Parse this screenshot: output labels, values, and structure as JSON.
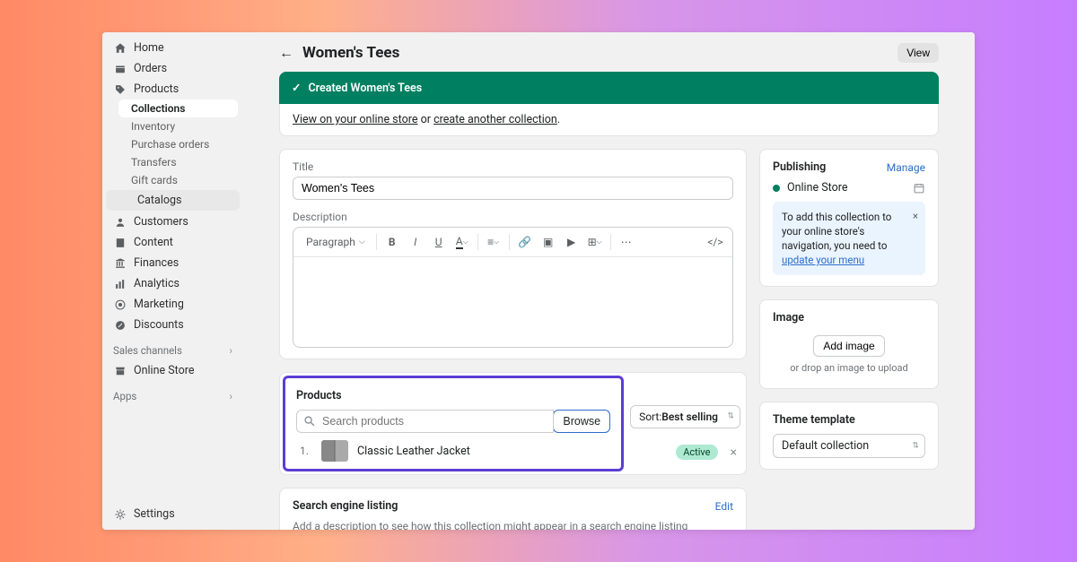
{
  "sidebar": {
    "home": "Home",
    "orders": "Orders",
    "products": "Products",
    "products_sub": [
      "Collections",
      "Inventory",
      "Purchase orders",
      "Transfers",
      "Gift cards"
    ],
    "catalogs": "Catalogs",
    "customers": "Customers",
    "content": "Content",
    "finances": "Finances",
    "analytics": "Analytics",
    "marketing": "Marketing",
    "discounts": "Discounts",
    "channels_head": "Sales channels",
    "online_store": "Online Store",
    "apps_head": "Apps",
    "settings": "Settings"
  },
  "header": {
    "title": "Women's Tees",
    "view": "View"
  },
  "banner": {
    "title": "Created Women's Tees",
    "link1": "View on your online store",
    "or": " or ",
    "link2": "create another collection"
  },
  "form": {
    "title_label": "Title",
    "title_value": "Women's Tees",
    "desc_label": "Description",
    "paragraph": "Paragraph"
  },
  "products": {
    "title": "Products",
    "search_placeholder": "Search products",
    "browse": "Browse",
    "sort_label": "Sort: ",
    "sort_value": "Best selling",
    "item_idx": "1.",
    "item_name": "Classic Leather Jacket",
    "item_status": "Active"
  },
  "seo": {
    "title": "Search engine listing",
    "edit": "Edit",
    "desc": "Add a description to see how this collection might appear in a search engine listing"
  },
  "publishing": {
    "title": "Publishing",
    "manage": "Manage",
    "channel": "Online Store",
    "alert_text": "To add this collection to your online store's navigation, you need to ",
    "alert_link": "update your menu"
  },
  "image": {
    "title": "Image",
    "add": "Add image",
    "hint": "or drop an image to upload"
  },
  "theme": {
    "title": "Theme template",
    "value": "Default collection"
  }
}
